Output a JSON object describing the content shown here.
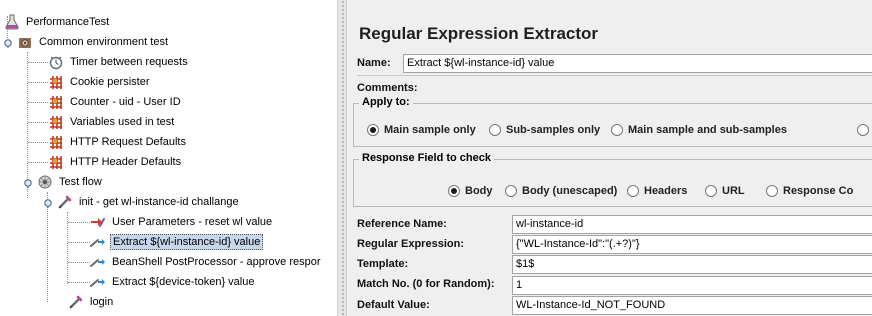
{
  "tree": {
    "root": "PerformanceTest",
    "common": "Common environment test",
    "timer": "Timer between requests",
    "cookie": "Cookie persister",
    "counter": "Counter - uid - User ID",
    "variables": "Variables used in test",
    "http_request_defaults": "HTTP Request Defaults",
    "http_header_defaults": "HTTP Header Defaults",
    "test_flow": "Test flow",
    "init": "init - get wl-instance-id challange",
    "user_params": "User Parameters - reset wl value",
    "extract_wl": "Extract ${wl-instance-id} value",
    "beanshell": "BeanShell PostProcessor - approve respor",
    "extract_device": "Extract ${device-token} value",
    "login": "login"
  },
  "panel": {
    "title": "Regular Expression Extractor",
    "name_label": "Name:",
    "name_value": "Extract ${wl-instance-id} value",
    "comments_label": "Comments:",
    "apply_to": {
      "legend": "Apply to:",
      "options": [
        "Main sample only",
        "Sub-samples only",
        "Main sample and sub-samples"
      ],
      "selected": "Main sample only"
    },
    "response_field": {
      "legend": "Response Field to check",
      "options": [
        "Body",
        "Body (unescaped)",
        "Headers",
        "URL",
        "Response Co"
      ],
      "selected": "Body"
    },
    "reference_name_label": "Reference Name:",
    "reference_name_value": "wl-instance-id",
    "regex_label": "Regular Expression:",
    "regex_value": "{\"WL-Instance-Id\":\"(.+?)\"}",
    "template_label": "Template:",
    "template_value": "$1$",
    "match_no_label": "Match No. (0 for Random):",
    "match_no_value": "1",
    "default_value_label": "Default Value:",
    "default_value_value": "WL-Instance-Id_NOT_FOUND"
  }
}
